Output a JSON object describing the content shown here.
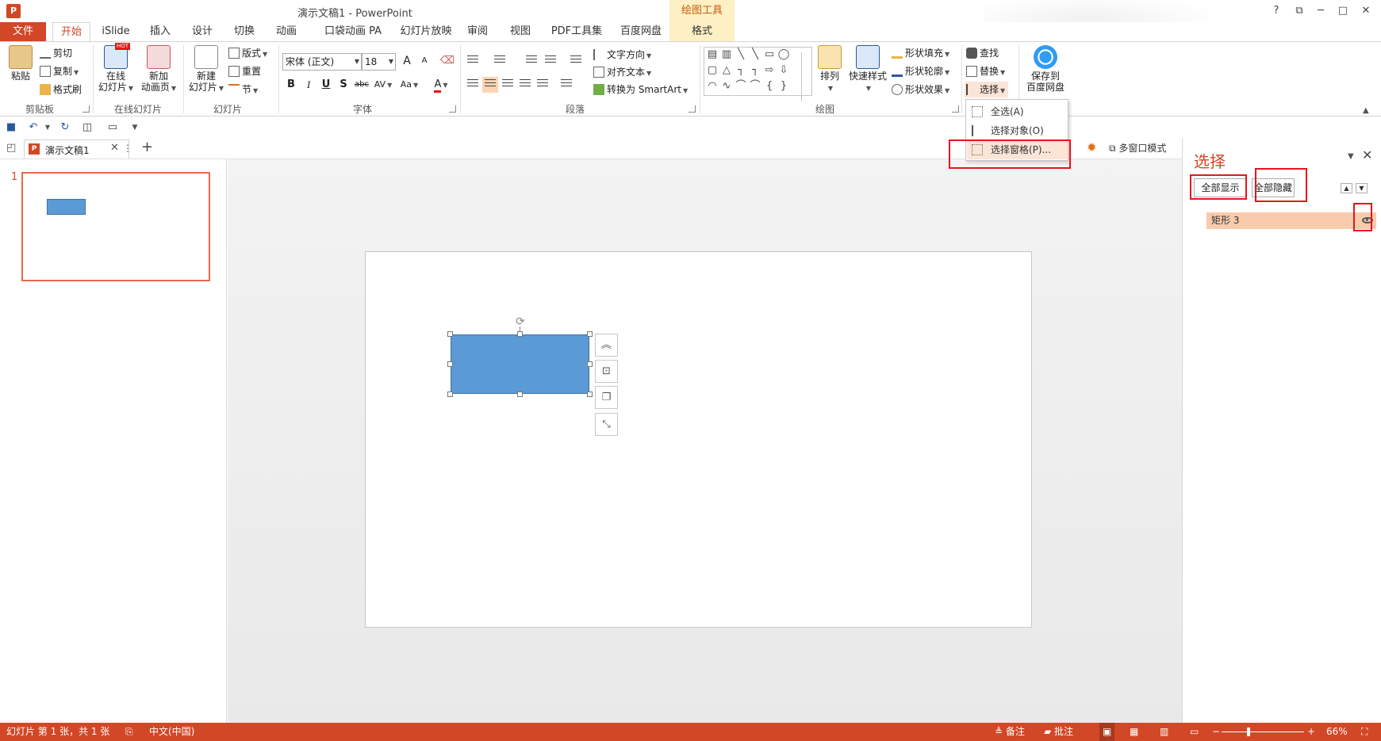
{
  "app": {
    "title": "演示文稿1 - PowerPoint",
    "logo": "P",
    "contextual_title": "绘图工具"
  },
  "window_controls": {
    "help": "?",
    "restore": "⧉",
    "minimize": "─",
    "maximize": "□",
    "close": "✕"
  },
  "tabs": [
    "文件",
    "开始",
    "iSlide",
    "插入",
    "设计",
    "切换",
    "动画",
    "口袋动画 PA",
    "幻灯片放映",
    "审阅",
    "视图",
    "PDF工具集",
    "百度网盘",
    "格式"
  ],
  "ribbon": {
    "clipboard": {
      "paste": "粘贴",
      "cut": "剪切",
      "copy": "复制",
      "format_painter": "格式刷",
      "label": "剪贴板"
    },
    "online_slides": {
      "online": "在线",
      "online_sub": "幻灯片",
      "new_anim": "新加",
      "new_anim_sub": "动画页",
      "label": "在线幻灯片"
    },
    "slides": {
      "new_slide": "新建",
      "new_slide_sub": "幻灯片",
      "layout": "版式",
      "reset": "重置",
      "section": "节",
      "label": "幻灯片"
    },
    "font": {
      "font_name": "宋体 (正文)",
      "font_size": "18",
      "bold": "B",
      "italic": "I",
      "underline": "U",
      "shadow": "S",
      "strike": "abc",
      "spacing": "AV",
      "case": "Aa",
      "color": "A",
      "grow": "A",
      "shrink": "A",
      "label": "字体"
    },
    "paragraph": {
      "text_direction": "文字方向",
      "align_text": "对齐文本",
      "smartart": "转换为 SmartArt",
      "label": "段落"
    },
    "drawing": {
      "arrange": "排列",
      "quick_styles": "快速样式",
      "fill": "形状填充",
      "outline": "形状轮廓",
      "effects": "形状效果",
      "label": "绘图"
    },
    "editing": {
      "find": "查找",
      "replace": "替换",
      "select": "选择"
    },
    "baidu": {
      "save": "保存到",
      "save_sub": "百度网盘"
    }
  },
  "select_menu": {
    "items": [
      "全选(A)",
      "选择对象(O)",
      "选择窗格(P)..."
    ]
  },
  "doc_tabs": {
    "tab_label": "演示文稿1",
    "close": "✕",
    "more": "⋮",
    "add": "+",
    "multiwindow": "多窗口模式"
  },
  "thumbnails": {
    "slide_number": "1"
  },
  "selection_pane": {
    "title": "选择",
    "show_all": "全部显示",
    "hide_all": "全部隐藏",
    "item": "矩形 3",
    "up": "▲",
    "down": "▼"
  },
  "status_bar": {
    "slide_info": "幻灯片 第 1 张，共 1 张",
    "language": "中文(中国)",
    "notes": "备注",
    "comments": "批注",
    "zoom": "66%",
    "minus": "−",
    "plus": "+"
  },
  "colors": {
    "accent": "#d24726",
    "shape_fill": "#5b9bd5",
    "highlight": "#f8cbad",
    "annotation": "#e8141b"
  }
}
